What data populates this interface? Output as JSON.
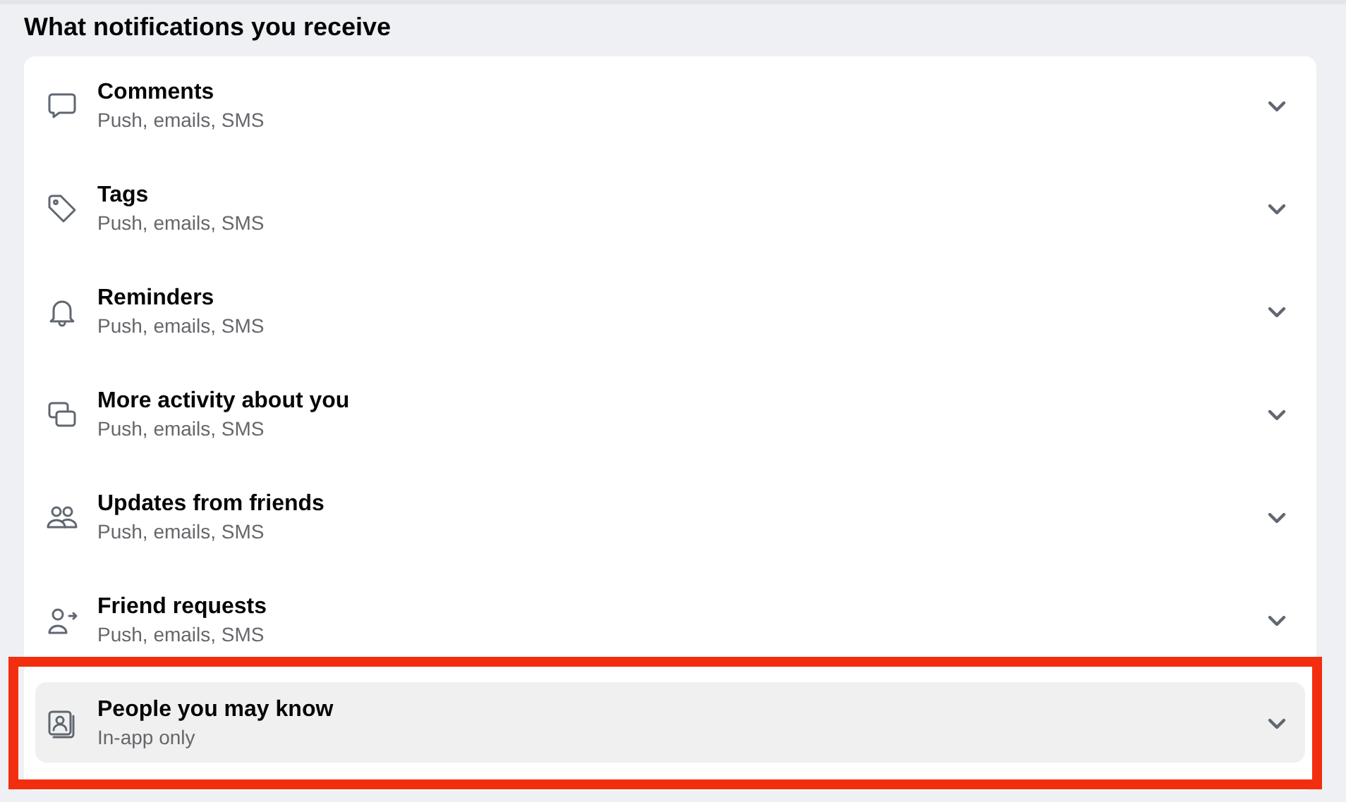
{
  "heading": "What notifications you receive",
  "items": [
    {
      "title": "Comments",
      "subtitle": "Push, emails, SMS",
      "highlighted": false
    },
    {
      "title": "Tags",
      "subtitle": "Push, emails, SMS",
      "highlighted": false
    },
    {
      "title": "Reminders",
      "subtitle": "Push, emails, SMS",
      "highlighted": false
    },
    {
      "title": "More activity about you",
      "subtitle": "Push, emails, SMS",
      "highlighted": false
    },
    {
      "title": "Updates from friends",
      "subtitle": "Push, emails, SMS",
      "highlighted": false
    },
    {
      "title": "Friend requests",
      "subtitle": "Push, emails, SMS",
      "highlighted": false
    },
    {
      "title": "People you may know",
      "subtitle": "In-app only",
      "highlighted": true
    }
  ]
}
